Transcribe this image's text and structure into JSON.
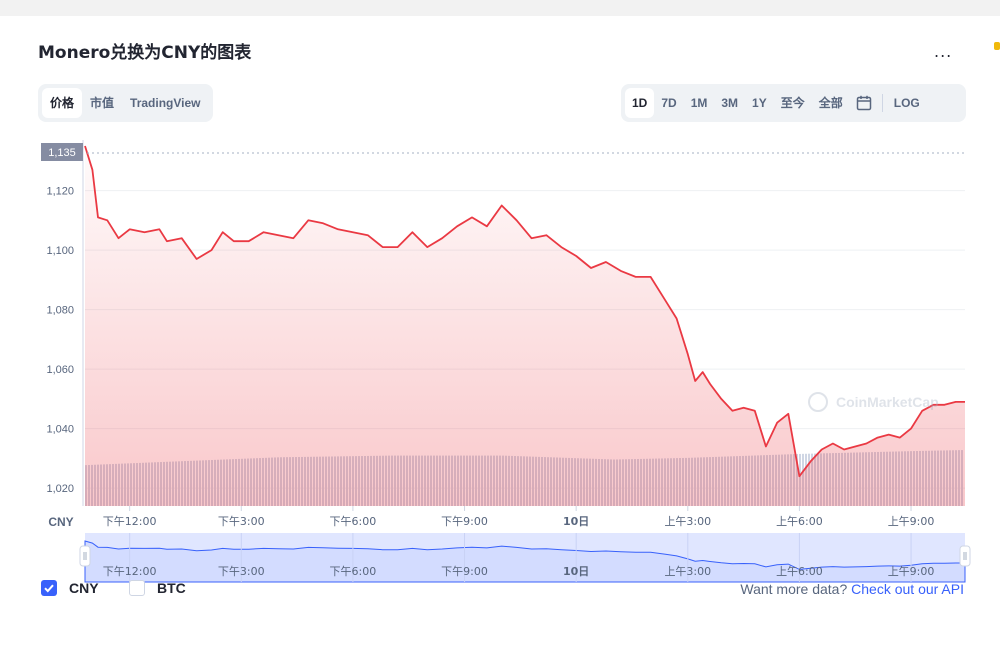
{
  "page": {
    "title": "Monero兑换为CNY的图表",
    "more_label": "..."
  },
  "view_tabs": [
    {
      "label": "价格",
      "active": true
    },
    {
      "label": "市值",
      "active": false
    },
    {
      "label": "TradingView",
      "active": false
    }
  ],
  "range_tabs": [
    {
      "label": "1D",
      "active": true
    },
    {
      "label": "7D",
      "active": false
    },
    {
      "label": "1M",
      "active": false
    },
    {
      "label": "3M",
      "active": false
    },
    {
      "label": "1Y",
      "active": false
    },
    {
      "label": "至今",
      "active": false
    },
    {
      "label": "全部",
      "active": false
    }
  ],
  "calendar_icon": "calendar-icon",
  "log_label": "LOG",
  "legend": [
    {
      "label": "CNY",
      "checked": true
    },
    {
      "label": "BTC",
      "checked": false
    }
  ],
  "api": {
    "prompt": "Want more data?",
    "link": "Check out our API"
  },
  "watermark": "CoinMarketCap",
  "colors": {
    "line": "#ea3943",
    "accent": "#3861fb",
    "volume": "#cfd6e4",
    "navigator_fill": "#e0e6ff",
    "navigator_line": "#3861fb"
  },
  "chart_data": {
    "type": "line",
    "title": "Monero兑换为CNY的图表",
    "ylabel": "CNY",
    "ylim": [
      1014,
      1137
    ],
    "y_ticks": [
      "1,020",
      "1,040",
      "1,060",
      "1,080",
      "1,100",
      "1,120"
    ],
    "current_value_label": "1,135",
    "current_value": 1135,
    "x_tick_labels": [
      "下午12:00",
      "下午3:00",
      "下午6:00",
      "下午9:00",
      "10日",
      "上午3:00",
      "上午6:00",
      "上午9:00"
    ],
    "x_range_hours": [
      10.8,
      34.45
    ],
    "x_tick_hours": [
      12,
      15,
      18,
      21,
      24,
      27,
      30,
      33
    ],
    "grid": true,
    "series": [
      {
        "name": "CNY",
        "x_hours": [
          10.8,
          11.0,
          11.15,
          11.4,
          11.7,
          12.0,
          12.4,
          12.8,
          13.0,
          13.4,
          13.8,
          14.2,
          14.5,
          14.8,
          15.2,
          15.6,
          16.0,
          16.4,
          16.8,
          17.2,
          17.6,
          18.0,
          18.4,
          18.8,
          19.2,
          19.6,
          20.0,
          20.4,
          20.8,
          21.2,
          21.6,
          22.0,
          22.4,
          22.8,
          23.2,
          23.6,
          24.0,
          24.4,
          24.8,
          25.2,
          25.6,
          26.0,
          26.4,
          26.7,
          27.0,
          27.2,
          27.4,
          27.6,
          27.9,
          28.2,
          28.5,
          28.8,
          29.1,
          29.4,
          29.7,
          30.0,
          30.3,
          30.6,
          30.9,
          31.2,
          31.5,
          31.8,
          32.1,
          32.4,
          32.7,
          33.0,
          33.3,
          33.6,
          33.9,
          34.2,
          34.45
        ],
        "values": [
          1135,
          1127,
          1111,
          1110,
          1104,
          1107,
          1106,
          1107,
          1103,
          1104,
          1097,
          1100,
          1106,
          1103,
          1103,
          1106,
          1105,
          1104,
          1110,
          1109,
          1107,
          1106,
          1105,
          1101,
          1101,
          1106,
          1101,
          1104,
          1108,
          1111,
          1108,
          1115,
          1110,
          1104,
          1105,
          1101,
          1098,
          1094,
          1096,
          1093,
          1091,
          1091,
          1083,
          1077,
          1065,
          1056,
          1059,
          1055,
          1050,
          1046,
          1047,
          1046,
          1034,
          1042,
          1045,
          1024,
          1029,
          1033,
          1035,
          1033,
          1034,
          1035,
          1037,
          1038,
          1037,
          1040,
          1046,
          1048,
          1048,
          1049,
          1049
        ]
      }
    ],
    "volume": {
      "x_hours": [
        10.8,
        13.0,
        16.0,
        19.0,
        22.0,
        25.0,
        27.0,
        30.0,
        33.0,
        34.45
      ],
      "relative": [
        0.73,
        0.79,
        0.87,
        0.9,
        0.9,
        0.83,
        0.86,
        0.93,
        0.98,
        1.0
      ]
    }
  }
}
